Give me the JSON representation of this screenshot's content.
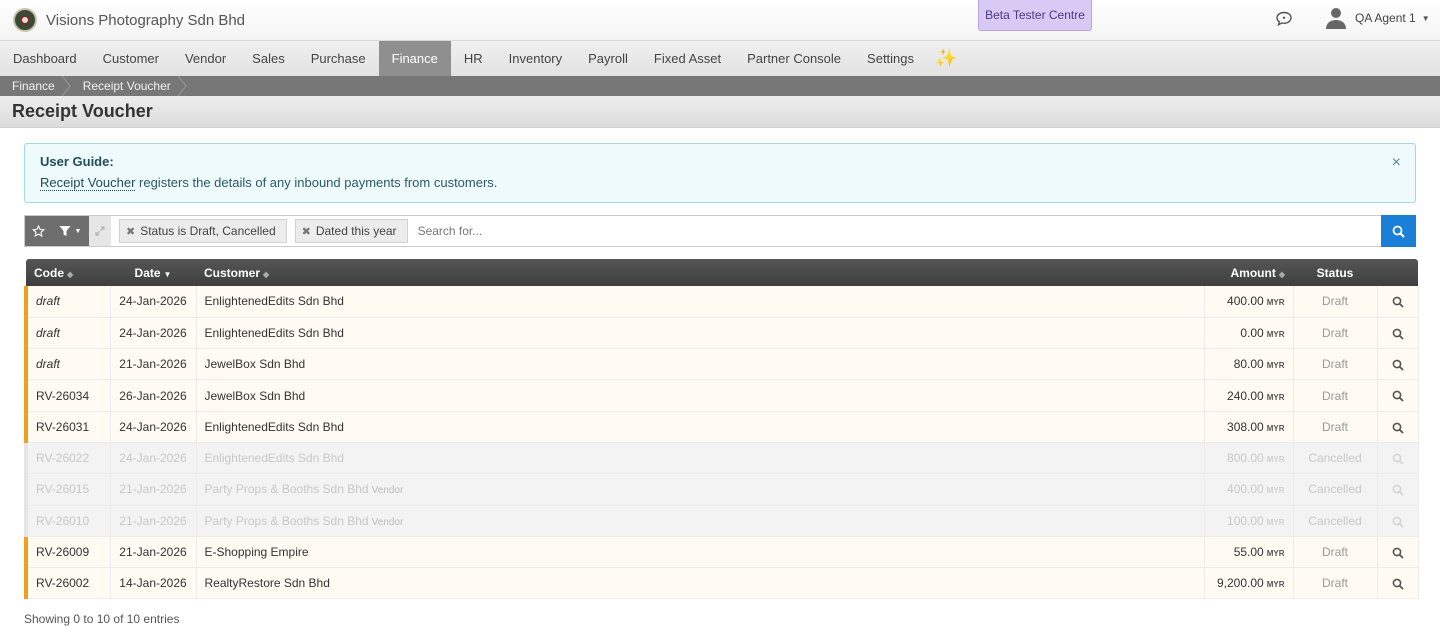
{
  "header": {
    "company_name": "Visions Photography Sdn Bhd",
    "beta_label": "Beta Tester Centre",
    "user_name": "QA Agent 1"
  },
  "nav": {
    "items": [
      {
        "label": "Dashboard"
      },
      {
        "label": "Customer"
      },
      {
        "label": "Vendor"
      },
      {
        "label": "Sales"
      },
      {
        "label": "Purchase"
      },
      {
        "label": "Finance",
        "active": true
      },
      {
        "label": "HR"
      },
      {
        "label": "Inventory"
      },
      {
        "label": "Payroll"
      },
      {
        "label": "Fixed Asset"
      },
      {
        "label": "Partner Console"
      },
      {
        "label": "Settings"
      }
    ],
    "sparkle_icon": "sparkle-icon"
  },
  "breadcrumb": [
    "Finance",
    "Receipt Voucher"
  ],
  "page": {
    "title": "Receipt Voucher"
  },
  "guide": {
    "title": "User Guide:",
    "link_text": "Receipt Voucher",
    "text": " registers the details of any inbound payments from customers.",
    "close": "×"
  },
  "search": {
    "chips": [
      "Status is Draft, Cancelled",
      "Dated this year"
    ],
    "placeholder": "Search for..."
  },
  "table": {
    "columns": {
      "code": "Code",
      "date": "Date",
      "customer": "Customer",
      "amount": "Amount",
      "status": "Status"
    },
    "rows": [
      {
        "code": "draft",
        "date": "24-Jan-2026",
        "customer": "EnlightenedEdits Sdn Bhd",
        "tag": "",
        "amount": "400.00",
        "currency": "MYR",
        "status": "Draft",
        "type": "draft"
      },
      {
        "code": "draft",
        "date": "24-Jan-2026",
        "customer": "EnlightenedEdits Sdn Bhd",
        "tag": "",
        "amount": "0.00",
        "currency": "MYR",
        "status": "Draft",
        "type": "draft"
      },
      {
        "code": "draft",
        "date": "21-Jan-2026",
        "customer": "JewelBox Sdn Bhd",
        "tag": "",
        "amount": "80.00",
        "currency": "MYR",
        "status": "Draft",
        "type": "draft"
      },
      {
        "code": "RV-26034",
        "date": "26-Jan-2026",
        "customer": "JewelBox Sdn Bhd",
        "tag": "",
        "amount": "240.00",
        "currency": "MYR",
        "status": "Draft",
        "type": "normal"
      },
      {
        "code": "RV-26031",
        "date": "24-Jan-2026",
        "customer": "EnlightenedEdits Sdn Bhd",
        "tag": "",
        "amount": "308.00",
        "currency": "MYR",
        "status": "Draft",
        "type": "normal"
      },
      {
        "code": "RV-26022",
        "date": "24-Jan-2026",
        "customer": "EnlightenedEdits Sdn Bhd",
        "tag": "",
        "amount": "800.00",
        "currency": "MYR",
        "status": "Cancelled",
        "type": "cancel"
      },
      {
        "code": "RV-26015",
        "date": "21-Jan-2026",
        "customer": "Party Props & Booths Sdn Bhd",
        "tag": "Vendor",
        "amount": "400.00",
        "currency": "MYR",
        "status": "Cancelled",
        "type": "cancel"
      },
      {
        "code": "RV-26010",
        "date": "21-Jan-2026",
        "customer": "Party Props & Booths Sdn Bhd",
        "tag": "Vendor",
        "amount": "100.00",
        "currency": "MYR",
        "status": "Cancelled",
        "type": "cancel"
      },
      {
        "code": "RV-26009",
        "date": "21-Jan-2026",
        "customer": "E-Shopping Empire",
        "tag": "",
        "amount": "55.00",
        "currency": "MYR",
        "status": "Draft",
        "type": "normal"
      },
      {
        "code": "RV-26002",
        "date": "14-Jan-2026",
        "customer": "RealtyRestore Sdn Bhd",
        "tag": "",
        "amount": "9,200.00",
        "currency": "MYR",
        "status": "Draft",
        "type": "normal"
      }
    ]
  },
  "footer": {
    "info": "Showing 0 to 10 of 10 entries"
  }
}
